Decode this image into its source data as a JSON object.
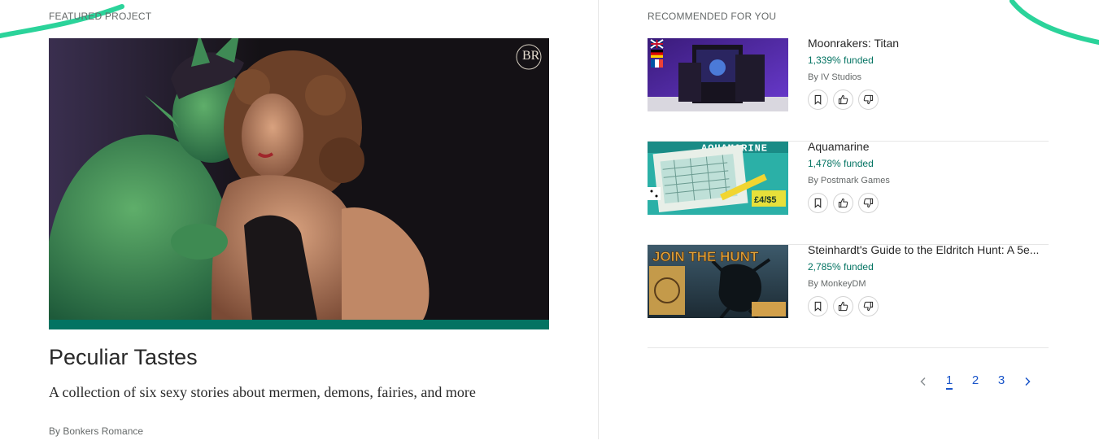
{
  "featured": {
    "section_label": "FEATURED PROJECT",
    "title": "Peculiar Tastes",
    "blurb": "A collection of six sexy stories about mermen, demons, fairies, and more",
    "creator": "By Bonkers Romance",
    "funding_progress": 1.0,
    "image_alt": "Illustration of a green horned demon embracing a curly-haired woman",
    "brand_mark_letters": "BR",
    "accent_color": "#037362"
  },
  "recommended": {
    "section_label": "RECOMMENDED FOR YOU",
    "items": [
      {
        "title": "Moonrakers: Titan",
        "funded": "1,339% funded",
        "creator": "By IV Studios",
        "thumb_alt": "Moonrakers Titan game box on purple background",
        "flags": [
          "uk-flag",
          "germany-flag",
          "france-flag"
        ]
      },
      {
        "title": "Aquamarine",
        "funded": "1,478% funded",
        "creator": "By Postmark Games",
        "thumb_alt": "Aquamarine roll and write game sheet with pens",
        "banner_text": "AQUAMARINE"
      },
      {
        "title": "Steinhardt's Guide to the Eldritch Hunt: A 5e...",
        "funded": "2,785% funded",
        "creator": "By MonkeyDM",
        "thumb_alt": "Join the Hunt eldritch monster artwork",
        "banner_text": "JOIN THE HUNT"
      }
    ],
    "actions": {
      "save_icon": "bookmark-icon",
      "like_icon": "thumbs-up-icon",
      "dislike_icon": "thumbs-down-icon"
    }
  },
  "pagination": {
    "pages": [
      "1",
      "2",
      "3"
    ],
    "current": "1",
    "prev_icon": "chevron-left-icon",
    "next_icon": "chevron-right-icon"
  },
  "colors": {
    "accent_green": "#037362",
    "link_blue": "#1a55c9",
    "swoosh_green": "#2bd39a",
    "divider": "#e6e6e6"
  }
}
